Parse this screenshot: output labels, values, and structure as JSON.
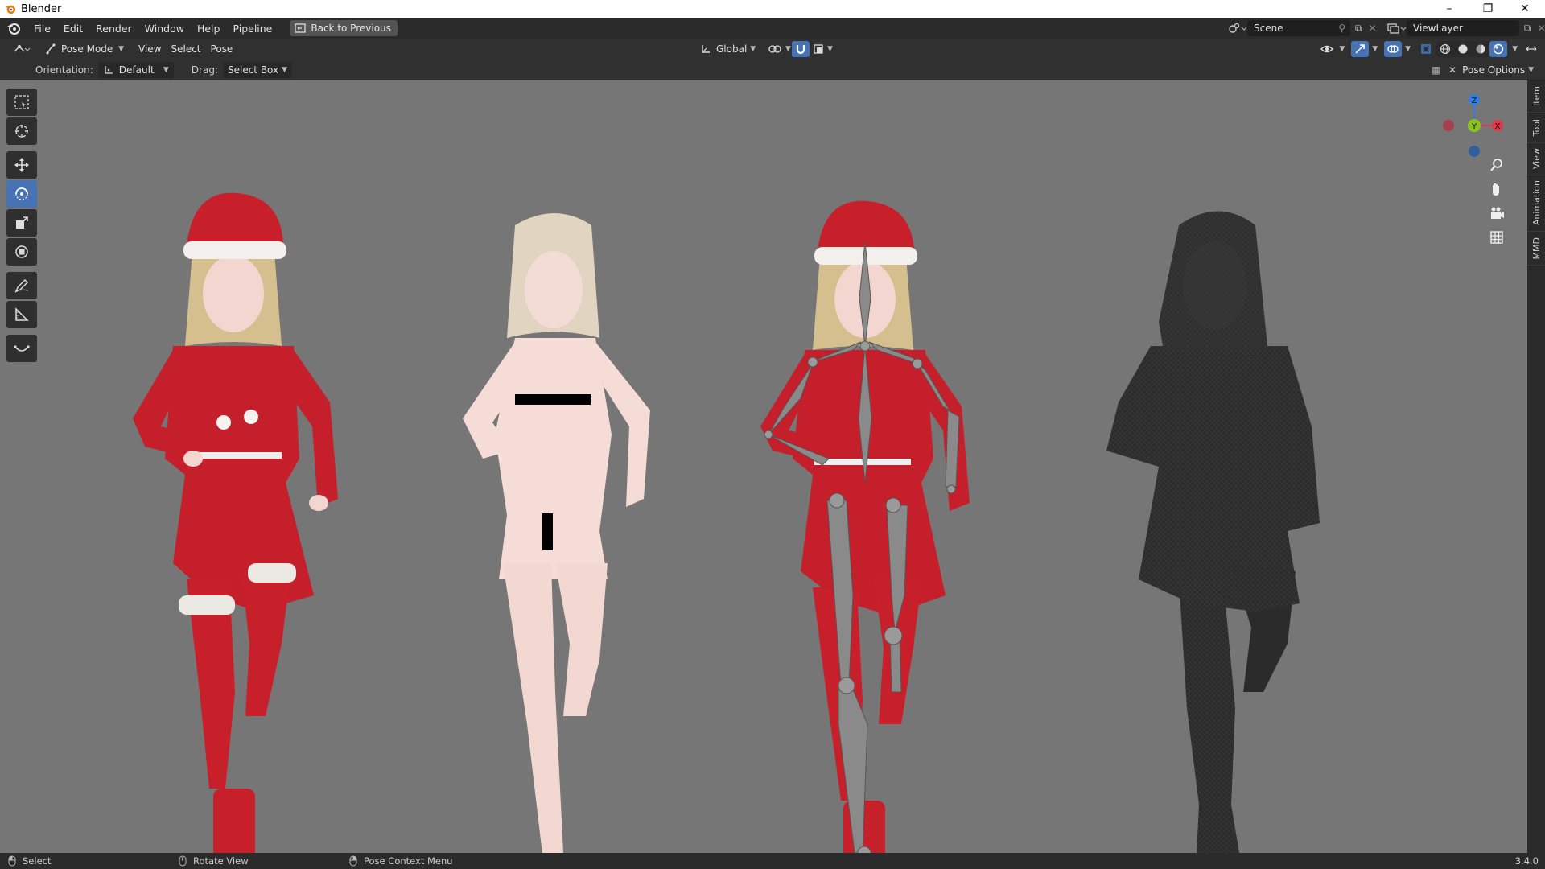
{
  "window": {
    "title": "Blender"
  },
  "menubar": {
    "items": [
      "File",
      "Edit",
      "Render",
      "Window",
      "Help",
      "Pipeline"
    ],
    "back_label": "Back to Previous",
    "scene": "Scene",
    "view_layer": "ViewLayer"
  },
  "header": {
    "mode": "Pose Mode",
    "menus": [
      "View",
      "Select",
      "Pose"
    ],
    "transform_orientation": "Global"
  },
  "tool_settings": {
    "orientation_label": "Orientation:",
    "orientation_value": "Default",
    "drag_label": "Drag:",
    "drag_value": "Select Box",
    "pose_options": "Pose Options"
  },
  "gizmo": {
    "z": "Z",
    "y": "Y",
    "x": "X"
  },
  "sidebar_tabs": [
    "Item",
    "Tool",
    "View",
    "Animation",
    "MMD"
  ],
  "statusbar": {
    "select": "Select",
    "rotate": "Rotate View",
    "context": "Pose Context Menu",
    "version": "3.4.0"
  },
  "colors": {
    "accent": "#4772b3",
    "viewport_bg": "#767676",
    "outfit_red": "#c8202a",
    "axis_x": "#e2364a",
    "axis_y": "#8ac222",
    "axis_z": "#2f7fe0"
  }
}
